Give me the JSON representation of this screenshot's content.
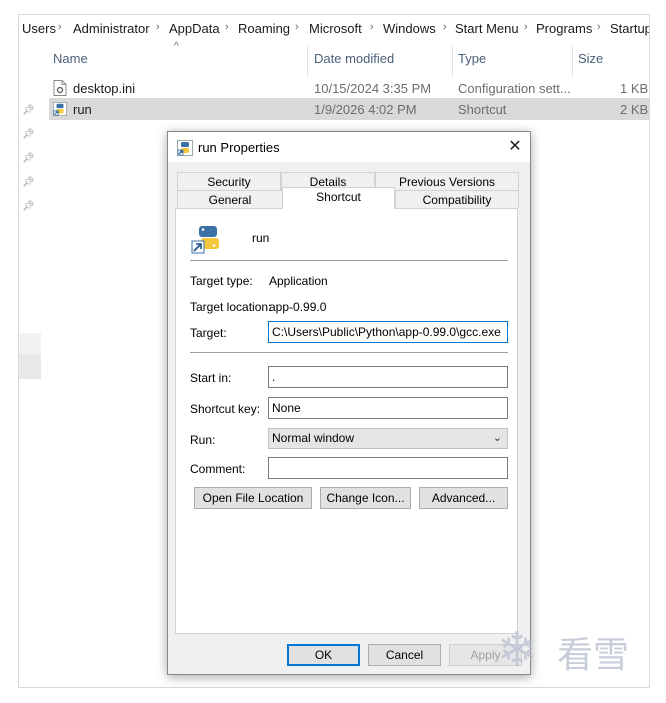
{
  "breadcrumb": [
    "Users",
    "Administrator",
    "AppData",
    "Roaming",
    "Microsoft",
    "Windows",
    "Start Menu",
    "Programs",
    "Startup"
  ],
  "columns": {
    "name": "Name",
    "date": "Date modified",
    "type": "Type",
    "size": "Size"
  },
  "files": [
    {
      "name": "desktop.ini",
      "date": "10/15/2024 3:35 PM",
      "type": "Configuration sett...",
      "size": "1 KB",
      "icon": "settings-file-icon"
    },
    {
      "name": "run",
      "date": "1/9/2026 4:02 PM",
      "type": "Shortcut",
      "size": "2 KB",
      "icon": "python-shortcut-icon"
    }
  ],
  "dialog": {
    "title": "run Properties",
    "close_glyph": "✕",
    "tabs_top": [
      "Security",
      "Details",
      "Previous Versions"
    ],
    "tabs_bottom": [
      "General",
      "Shortcut",
      "Compatibility"
    ],
    "active_tab": "Shortcut",
    "shortcut_name": "run",
    "target_type_label": "Target type:",
    "target_type_value": "Application",
    "target_location_label": "Target location:",
    "target_location_value": "app-0.99.0",
    "target_label": "Target:",
    "target_value": "C:\\Users\\Public\\Python\\app-0.99.0\\gcc.exe",
    "start_in_label": "Start in:",
    "start_in_value": ".",
    "shortcut_key_label": "Shortcut key:",
    "shortcut_key_value": "None",
    "run_label": "Run:",
    "run_value": "Normal window",
    "comment_label": "Comment:",
    "comment_value": "",
    "open_file_location": "Open File Location",
    "change_icon": "Change Icon...",
    "advanced": "Advanced...",
    "ok": "OK",
    "cancel": "Cancel",
    "apply": "Apply"
  },
  "watermark": {
    "text": "看雪"
  },
  "colors": {
    "accent": "#0078d7",
    "selection": "#d9d9d9",
    "python_blue": "#3a72a8",
    "python_yellow": "#f2c73c"
  }
}
